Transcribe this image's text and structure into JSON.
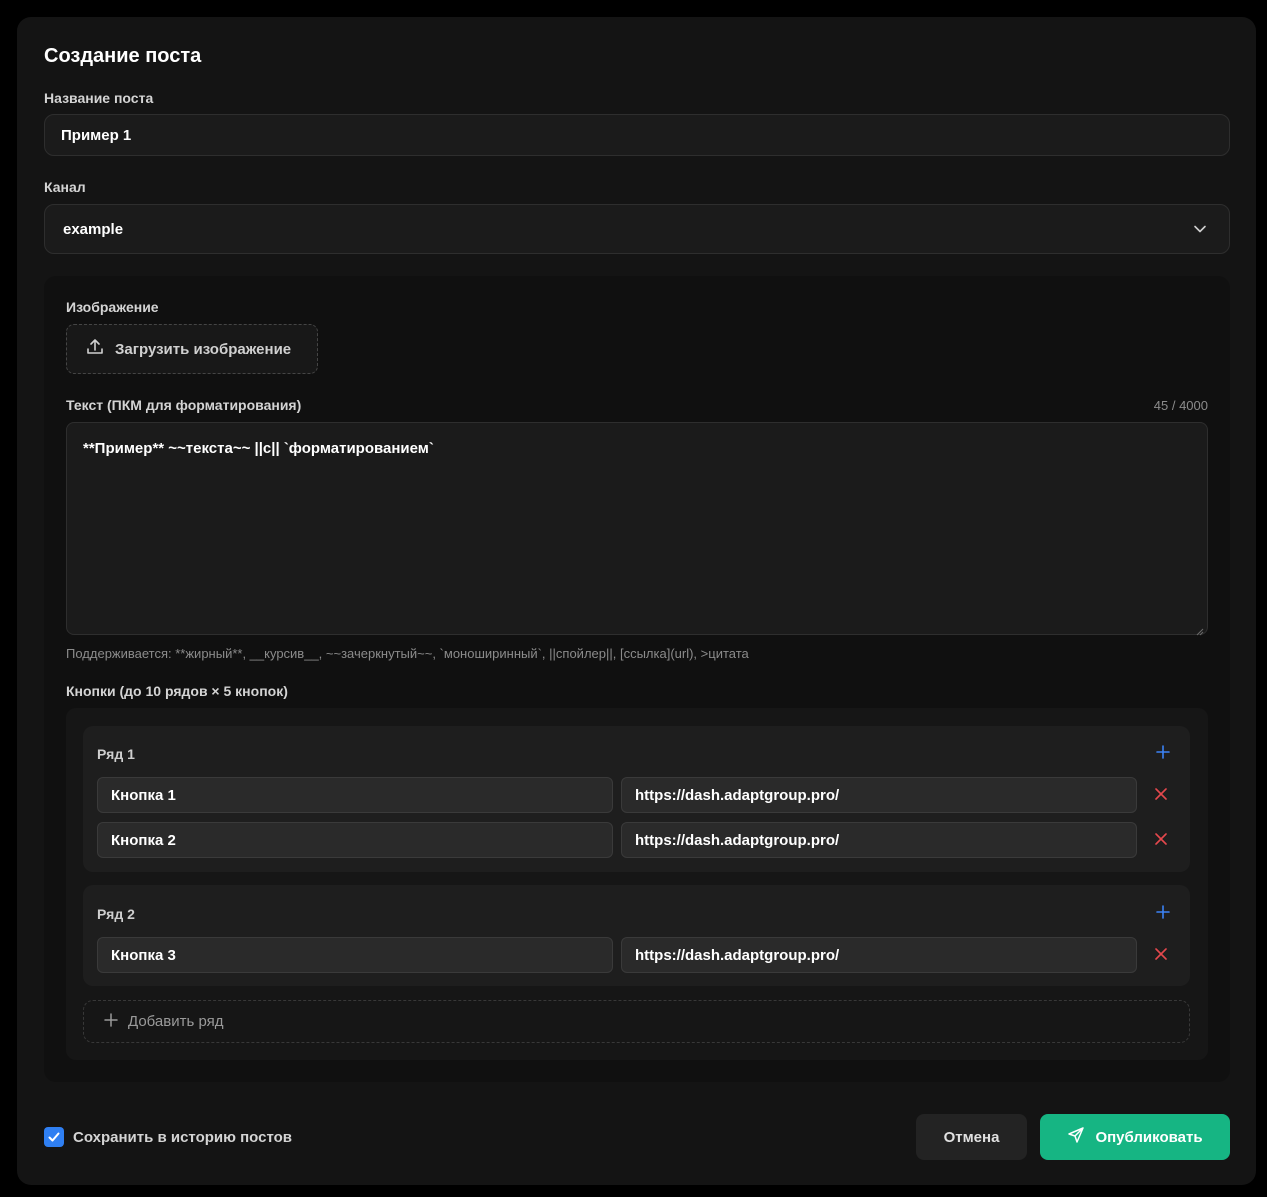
{
  "dialog": {
    "title": "Создание поста",
    "post_name_label": "Название поста",
    "post_name_value": "Пример 1",
    "channel_label": "Канал",
    "channel_value": "example"
  },
  "editor": {
    "image_label": "Изображение",
    "upload_label": "Загрузить изображение",
    "text_label": "Текст (ПКМ для форматирования)",
    "counter": "45 / 4000",
    "text_value": "**Пример** ~~текста~~ ||с|| `форматированием`",
    "hint": "Поддерживается: **жирный**, __курсив__, ~~зачеркнутый~~, `моноширинный`, ||спойлер||, [ссылка](url), >цитата",
    "buttons_label": "Кнопки (до 10 рядов × 5 кнопок)",
    "rows": [
      {
        "title": "Ряд 1",
        "buttons": [
          {
            "name": "Кнопка 1",
            "url": "https://dash.adaptgroup.pro/"
          },
          {
            "name": "Кнопка 2",
            "url": "https://dash.adaptgroup.pro/"
          }
        ]
      },
      {
        "title": "Ряд 2",
        "buttons": [
          {
            "name": "Кнопка 3",
            "url": "https://dash.adaptgroup.pro/"
          }
        ]
      }
    ],
    "add_row_label": "Добавить ряд"
  },
  "footer": {
    "save_history_label": "Сохранить в историю постов",
    "save_history_checked": true,
    "cancel_label": "Отмена",
    "publish_label": "Опубликовать"
  },
  "icons": {
    "upload": "upload-icon",
    "chevron": "chevron-down-icon",
    "plus": "plus-icon",
    "delete": "close-icon",
    "check": "check-icon",
    "send": "send-icon"
  },
  "colors": {
    "accent_blue": "#2f7ff2",
    "publish_green": "#16b583",
    "delete_red": "#e5484d"
  }
}
